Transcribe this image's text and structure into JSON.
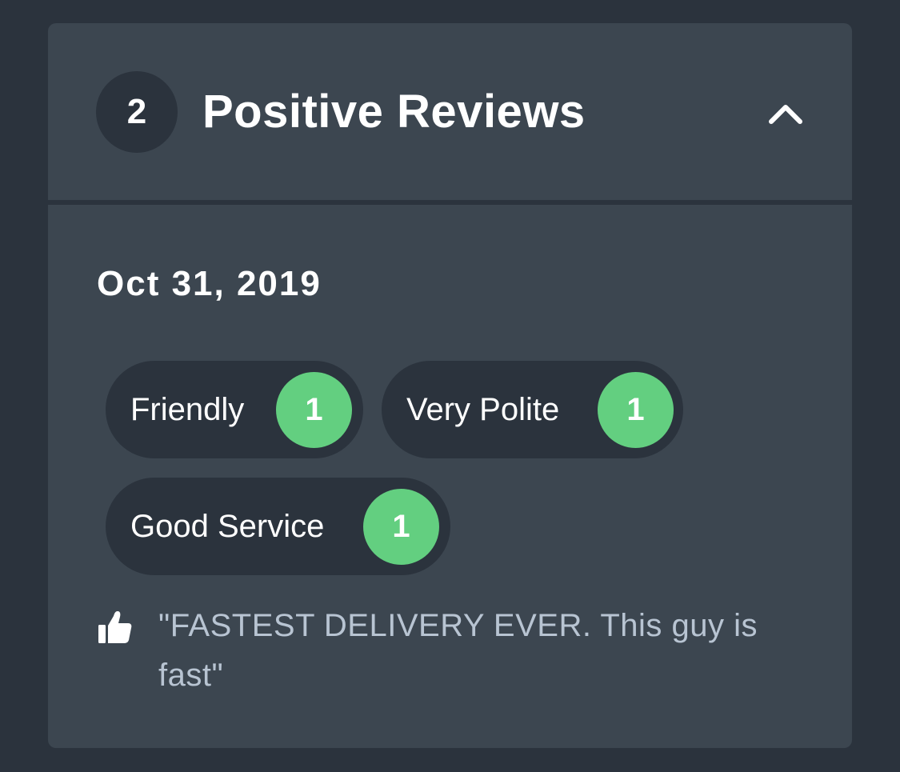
{
  "section": {
    "count": "2",
    "title": "Positive Reviews",
    "toggle_icon": "chevron-up-icon"
  },
  "review": {
    "date": "Oct 31, 2019",
    "tags": [
      {
        "label": "Friendly",
        "count": "1"
      },
      {
        "label": "Very Polite",
        "count": "1"
      },
      {
        "label": "Good Service",
        "count": "1"
      }
    ],
    "quote_icon": "thumbs-up-icon",
    "quote": "\"FASTEST DELIVERY EVER. This guy is fast\""
  },
  "colors": {
    "background": "#2b333d",
    "card": "#3c4650",
    "badge_green": "#63cf80",
    "quote_text": "#b8c4d2"
  }
}
